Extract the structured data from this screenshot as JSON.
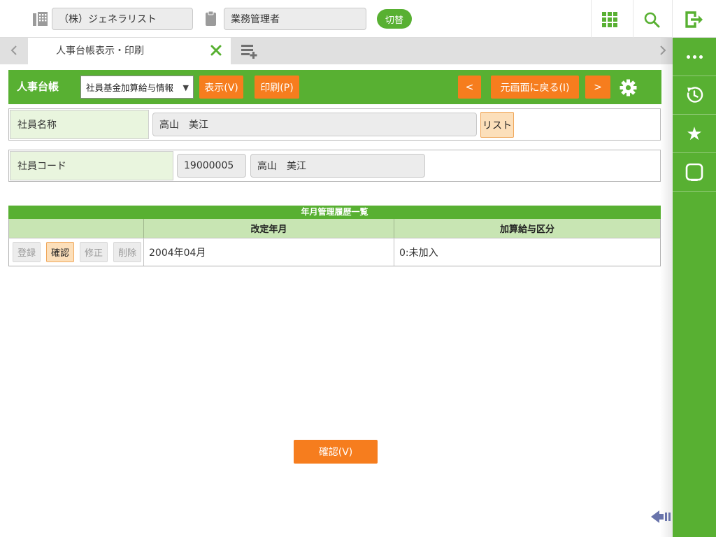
{
  "top_bar": {
    "company": "（株）ジェネラリスト",
    "role": "業務管理者",
    "switch_label": "切替"
  },
  "tab_bar": {
    "active_label": "人事台帳表示・印刷"
  },
  "toolbar": {
    "title": "人事台帳",
    "dropdown_value": "社員基金加算給与情報",
    "show_label": "表示(V)",
    "print_label": "印刷(P)",
    "prev_label": "<",
    "back_label": "元画面に戻る(I)",
    "next_label": ">"
  },
  "fields": {
    "name": {
      "label": "社員名称",
      "value": "高山　美江",
      "list_label": "リスト"
    },
    "code": {
      "label": "社員コード",
      "code": "19000005",
      "name": "高山　美江"
    }
  },
  "table": {
    "title": "年月管理履歴一覧",
    "columns": [
      "",
      "改定年月",
      "加算給与区分"
    ],
    "row_buttons": [
      "登録",
      "確認",
      "修正",
      "削除"
    ],
    "rows": [
      {
        "revision": "2004年04月",
        "category": "0:未加入"
      }
    ]
  },
  "footer": {
    "confirm_label": "確認(V)"
  },
  "colors": {
    "accent_green": "#58b032",
    "accent_orange": "#f67d1e",
    "highlight_peach": "#fcdfba"
  }
}
